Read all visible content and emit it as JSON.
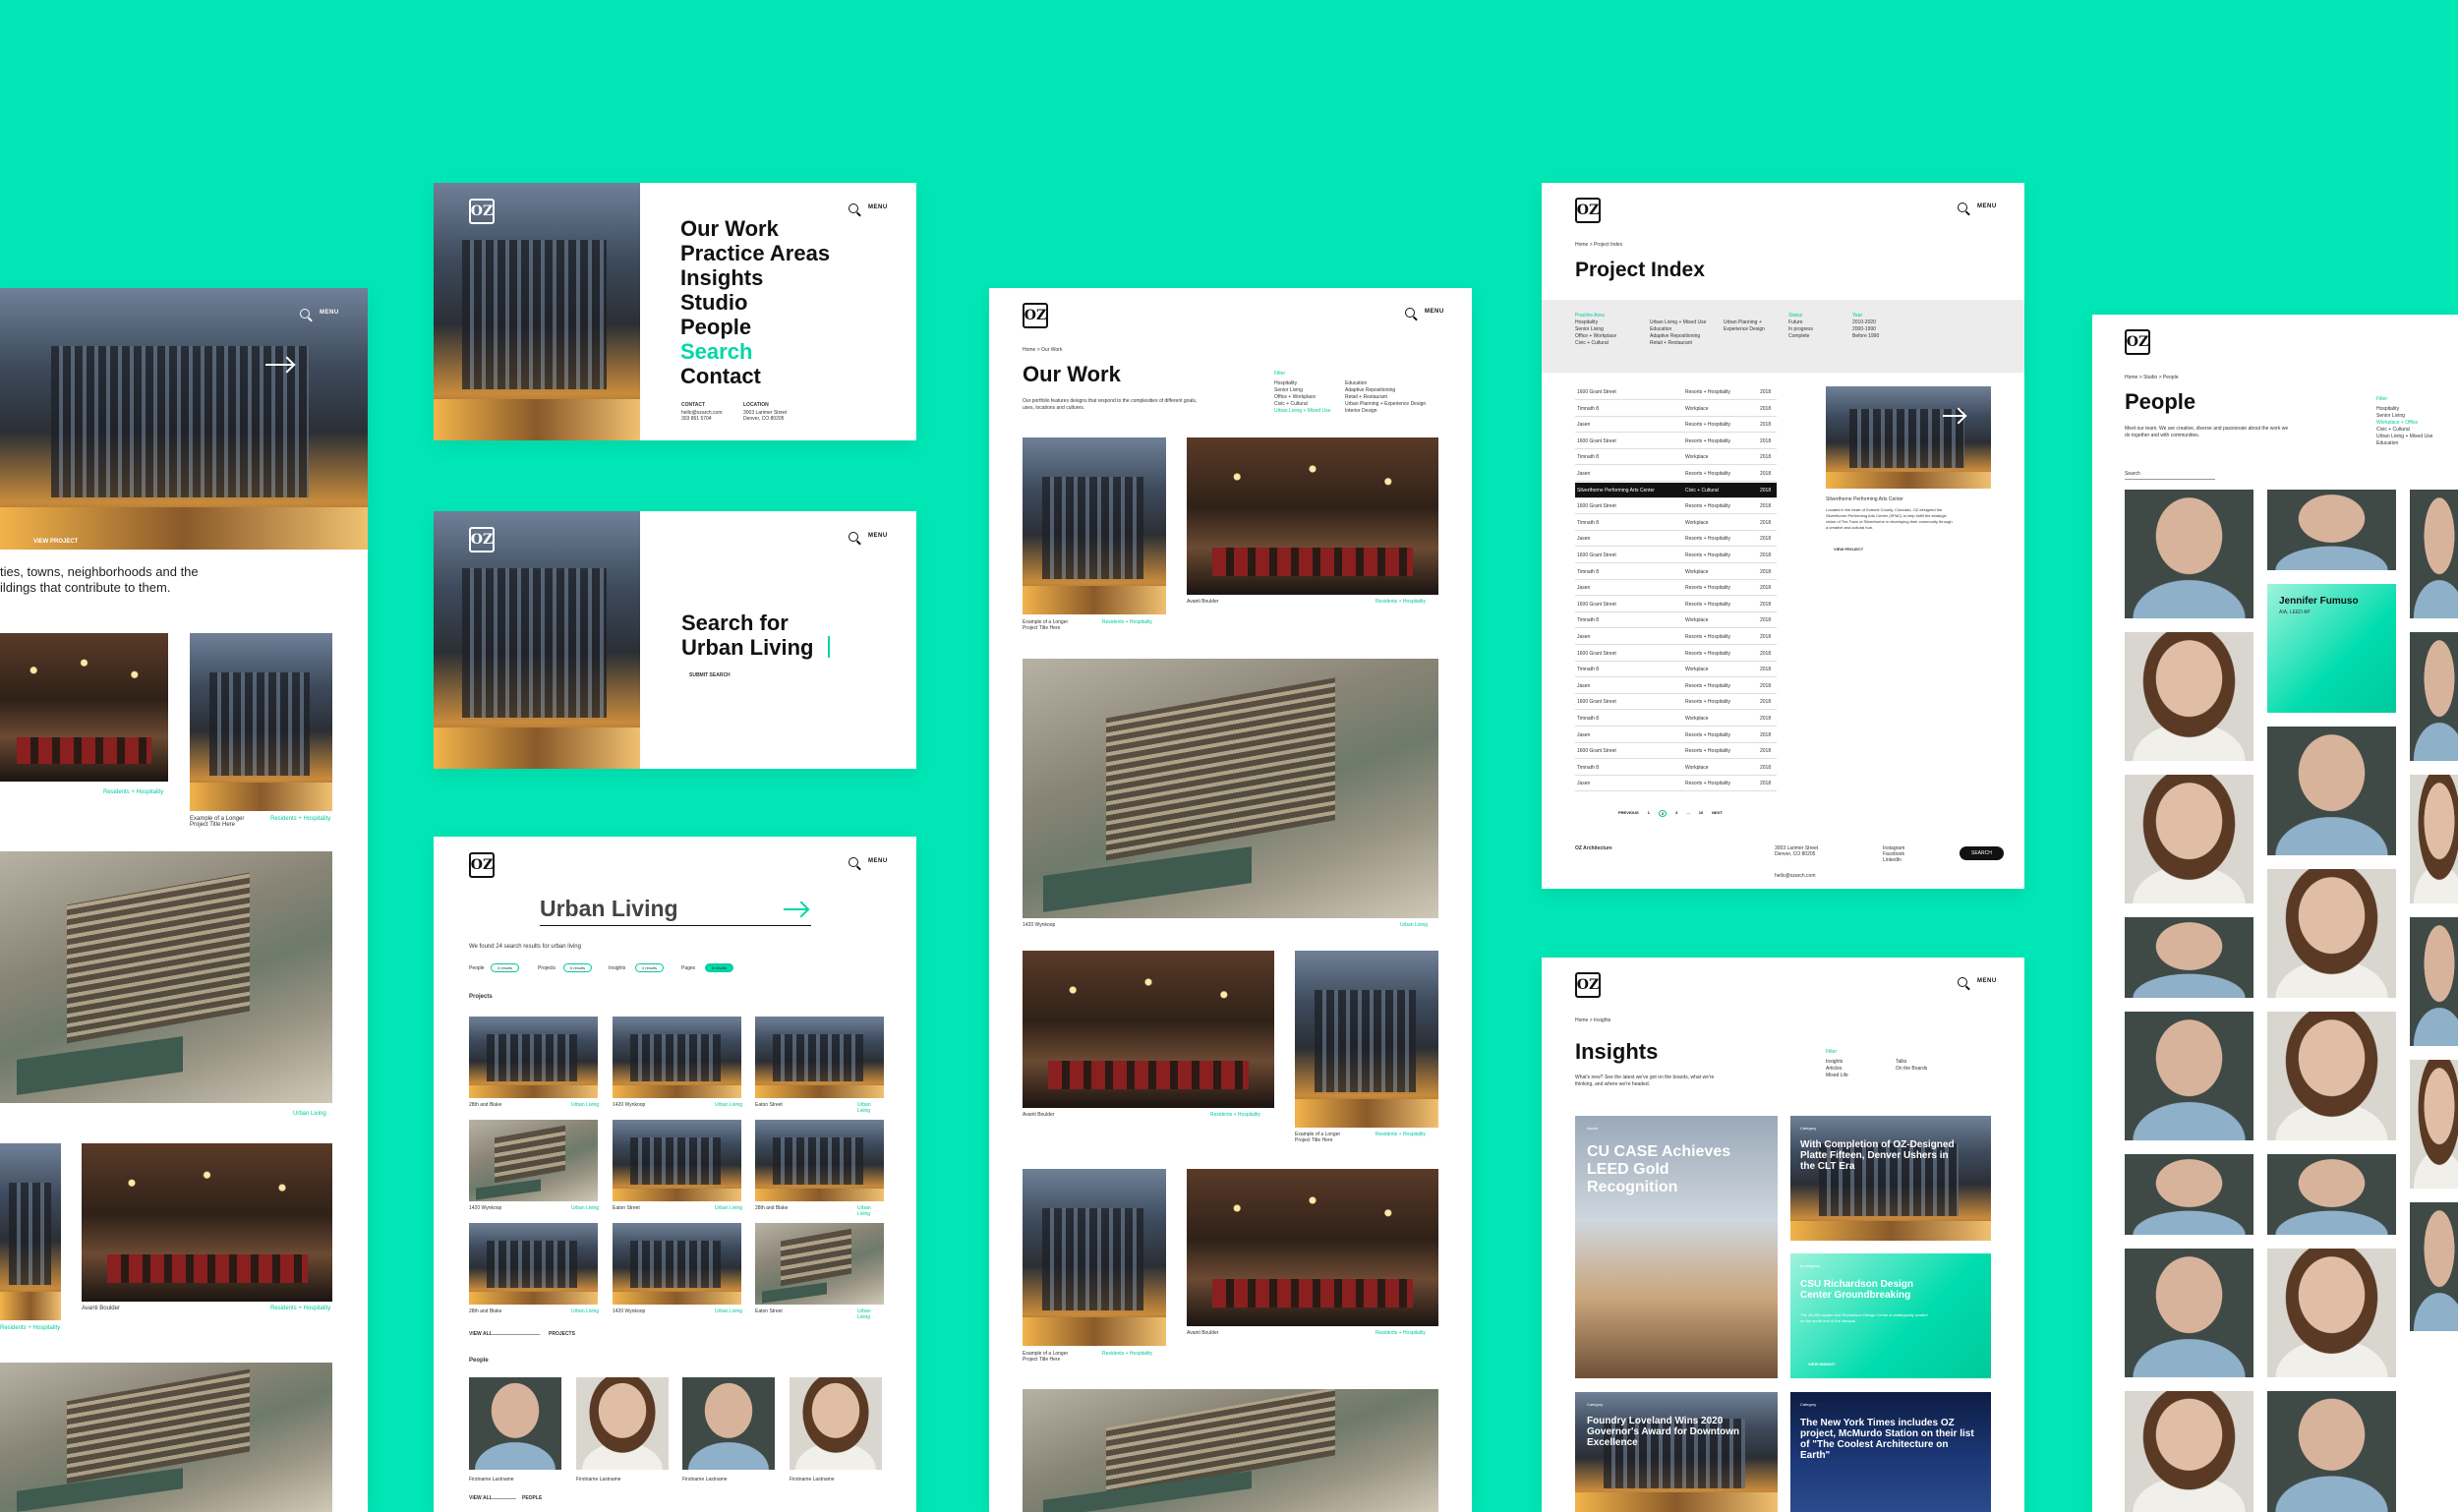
{
  "brand": {
    "logo": "OZ",
    "accent": "#00d7a8",
    "background": "#00e6b5"
  },
  "nav": {
    "menu_label": "MENU"
  },
  "card1": {
    "intro": "ties, towns, neighborhoods and the\nildings that contribute to them.",
    "view_project": "VIEW PROJECT",
    "captions": [
      "Example of a Longer\nProject Title Here",
      "Avanti Boulder"
    ],
    "tags": [
      "Residents + Hospitality",
      "Residents + Hospitality",
      "Urban Living",
      "Residents + Hospitality",
      "Residents + Hospitality"
    ]
  },
  "menu_card": {
    "items": [
      "Our Work",
      "Practice Areas",
      "Insights",
      "Studio",
      "People",
      "Search",
      "Contact"
    ],
    "contact_label": "CONTACT",
    "contact_lines": "hello@ozarch.com\n303 861 5704",
    "location_label": "LOCATION",
    "location_lines": "3003 Larimer Street\nDenver, CO 80205"
  },
  "search_card": {
    "title": "Search for\nUrban Living",
    "submit": "SUBMIT SEARCH"
  },
  "results_card": {
    "query": "Urban Living",
    "summary": "We found 24 search results for urban living",
    "filters": [
      {
        "label": "People",
        "count": "4 results"
      },
      {
        "label": "Projects",
        "count": "6 results"
      },
      {
        "label": "Insights",
        "count": "4 results"
      },
      {
        "label": "Pages",
        "count": "6 results"
      }
    ],
    "projects_heading": "Projects",
    "projects": [
      {
        "name": "28th and Blake",
        "tag": "Urban Living"
      },
      {
        "name": "1420 Wynkoop",
        "tag": "Urban Living"
      },
      {
        "name": "Eaton Street",
        "tag": "Urban Living"
      },
      {
        "name": "1420 Wynkoop",
        "tag": "Urban Living"
      },
      {
        "name": "Eaton Street",
        "tag": "Urban Living"
      },
      {
        "name": "28th and Blake",
        "tag": "Urban Living"
      },
      {
        "name": "28th and Blake",
        "tag": "Urban Living"
      },
      {
        "name": "1420 Wynkoop",
        "tag": "Urban Living"
      },
      {
        "name": "Eaton Street",
        "tag": "Urban Living"
      }
    ],
    "view_all_projects": "VIEW ALL",
    "projects_word": "PROJECTS",
    "people_heading": "People",
    "people": [
      "Firstname Lastname",
      "Firstname Lastname",
      "Firstname Lastname",
      "Firstname Lastname"
    ],
    "view_all_people": "VIEW ALL",
    "people_word": "PEOPLE"
  },
  "our_work": {
    "breadcrumb": "Home > Our Work",
    "title": "Our Work",
    "description": "Our portfolio features designs that respond to the complexities of different goals, uses, locations and cultures.",
    "filter_title": "Filter",
    "filters_col1": [
      "Hospitality",
      "Senior Living",
      "Office + Workplace",
      "Civic + Cultural",
      "Urban Living + Mixed Use"
    ],
    "filters_col2": [
      "Education",
      "Adaptive Repositioning",
      "Retail + Restaurant",
      "Urban Planning + Experience Design",
      "Interior Design"
    ],
    "captions": [
      "Example of a Longer\nProject Title Here",
      "Avanti Boulder",
      "1420 Wynkoop",
      "Avanti Boulder",
      "Example of a Longer\nProject Title Here",
      "Example of a Longer\nProject Title Here",
      "Avanti Boulder"
    ],
    "tags": [
      "Residents + Hospitality",
      "Residents + Hospitality",
      "Urban Living",
      "Residents + Hospitality",
      "Residents + Hospitality",
      "Residents + Hospitality",
      "Residents + Hospitality"
    ]
  },
  "project_index": {
    "breadcrumb": "Home > Project Index",
    "title": "Project Index",
    "filter_groups": [
      {
        "label": "Practice Area",
        "items": [
          "Hospitality",
          "Senior Living",
          "Office + Workplace",
          "Civic + Cultural"
        ]
      },
      {
        "label": "",
        "items": [
          "Urban Living + Mixed Use",
          "Education",
          "Adaptive Repositioning",
          "Retail + Restaurant"
        ]
      },
      {
        "label": "",
        "items": [
          "Urban Planning +\nExperience Design"
        ]
      },
      {
        "label": "Status",
        "items": [
          "Future",
          "In progress",
          "Complete"
        ]
      },
      {
        "label": "Year",
        "items": [
          "2010-2020",
          "2000-1990",
          "Before 1990"
        ]
      }
    ],
    "rows": [
      [
        "1600 Grant Street",
        "Resorts + Hospitality",
        "2018"
      ],
      [
        "Timnath 8",
        "Workplace",
        "2018"
      ],
      [
        "Jasen",
        "Resorts + Hospitality",
        "2018"
      ],
      [
        "1600 Grant Street",
        "Resorts + Hospitality",
        "2018"
      ],
      [
        "Timnath 8",
        "Workplace",
        "2018"
      ],
      [
        "Jasen",
        "Resorts + Hospitality",
        "2018"
      ],
      [
        "Silverthorne Performing Arts Center",
        "Civic + Cultural",
        "2018"
      ],
      [
        "1600 Grant Street",
        "Resorts + Hospitality",
        "2018"
      ],
      [
        "Timnath 8",
        "Workplace",
        "2018"
      ],
      [
        "Jasen",
        "Resorts + Hospitality",
        "2018"
      ],
      [
        "1600 Grant Street",
        "Resorts + Hospitality",
        "2018"
      ],
      [
        "Timnath 8",
        "Workplace",
        "2018"
      ],
      [
        "Jasen",
        "Resorts + Hospitality",
        "2018"
      ],
      [
        "1600 Grant Street",
        "Resorts + Hospitality",
        "2018"
      ],
      [
        "Timnath 8",
        "Workplace",
        "2018"
      ],
      [
        "Jasen",
        "Resorts + Hospitality",
        "2018"
      ],
      [
        "1600 Grant Street",
        "Resorts + Hospitality",
        "2018"
      ],
      [
        "Timnath 8",
        "Workplace",
        "2018"
      ],
      [
        "Jasen",
        "Resorts + Hospitality",
        "2018"
      ],
      [
        "1600 Grant Street",
        "Resorts + Hospitality",
        "2018"
      ],
      [
        "Timnath 8",
        "Workplace",
        "2018"
      ],
      [
        "Jasen",
        "Resorts + Hospitality",
        "2018"
      ],
      [
        "1600 Grant Street",
        "Resorts + Hospitality",
        "2018"
      ],
      [
        "Timnath 8",
        "Workplace",
        "2018"
      ],
      [
        "Jasen",
        "Resorts + Hospitality",
        "2018"
      ]
    ],
    "preview_title": "Silverthorne Performing Arts Center",
    "preview_text": "Located in the heart of Summit County, Colorado, OZ designed the Silverthorne Performing Arts Center (SPAC) to help fulfill the strategic vision of The Town of Silverthorne in developing their community through a creative and cultural hub.",
    "view_project": "VIEW PROJECT",
    "pagination": [
      "PREVIOUS",
      "1",
      "2",
      "3",
      "...",
      "10",
      "NEXT"
    ],
    "footer_brand": "OZ Architecture",
    "footer_address": "3003 Larimer Street\nDenver, CO 80205",
    "footer_email": "hello@ozarch.com",
    "footer_social": "Instagram\nFacebook\nLinkedIn",
    "footer_button": "SEARCH"
  },
  "insights": {
    "breadcrumb": "Home > Insights",
    "title": "Insights",
    "description": "What's new? See the latest we've got on the boards, what we're thinking, and where we're headed.",
    "filter_title": "Filter",
    "filters_col1": [
      "Insights",
      "Articles",
      "Mixed Life"
    ],
    "filters_col2": [
      "Talks",
      "On the Boards"
    ],
    "cards": [
      {
        "label": "Award",
        "title": "CU CASE Achieves LEED Gold Recognition"
      },
      {
        "label": "Category",
        "title": "With Completion of OZ-Designed Platte Fifteen, Denver Ushers in the CLT Era"
      },
      {
        "label": "In progress",
        "title": "CSU Richardson Design Center Groundbreaking",
        "text": "The 45,000 square foot Richardson Design Center is strategically located on the south end of the campus.",
        "link": "VIEW INSIGHT"
      },
      {
        "label": "Category",
        "title": "Foundry Loveland Wins 2020 Governor's Award for Downtown Excellence"
      },
      {
        "label": "Category",
        "title": "The New York Times includes OZ project, McMurdo Station on their list of \"The Coolest Architecture on Earth\""
      }
    ]
  },
  "people": {
    "breadcrumb": "Home > Studio > People",
    "title": "People",
    "description": "Meet our team. We are creative, diverse and passionate about the work we do together and with communities.",
    "search_label": "Search",
    "filter_title": "Filter",
    "filters": [
      "Hospitality",
      "Senior Living",
      "Workplace + Office",
      "Civic + Cultural",
      "Urban Living + Mixed Use",
      "Education"
    ],
    "featured_name": "Jennifer Fumuso",
    "featured_role": "AIA, LEED AP"
  }
}
